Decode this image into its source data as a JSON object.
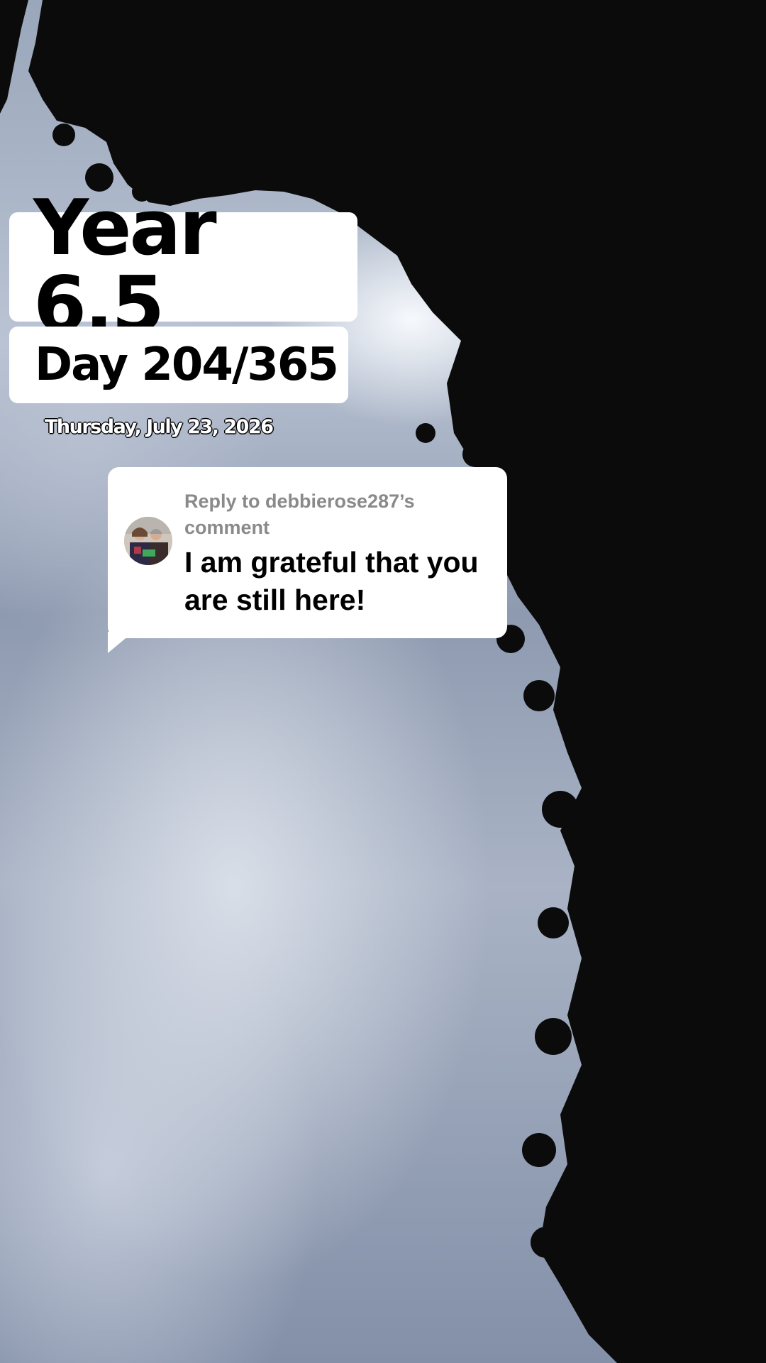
{
  "overlay": {
    "year": "Year 6.5",
    "day": "Day 204/365",
    "date": "Thursday, July 23, 2026"
  },
  "reply": {
    "label": "Reply to debbierose287’s comment",
    "text": "I am grateful that you are still here!",
    "avatar_icon": "avatar-photo-icon"
  },
  "colors": {
    "overlay_bg": "#ffffff",
    "reply_label": "#8a8a8a",
    "text": "#000000",
    "tree_silhouette": "#0b0b0b"
  }
}
